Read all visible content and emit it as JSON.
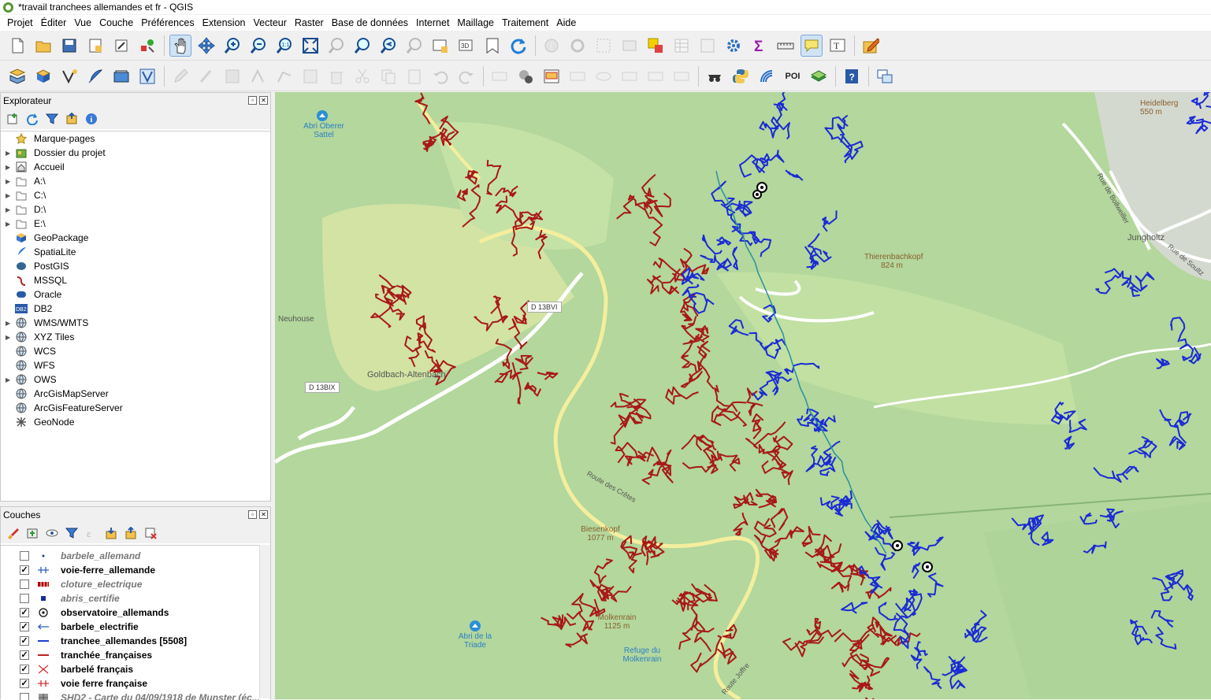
{
  "window": {
    "title": "*travail tranchees allemandes et fr - QGIS"
  },
  "menu": [
    "Projet",
    "Éditer",
    "Vue",
    "Couche",
    "Préférences",
    "Extension",
    "Vecteur",
    "Raster",
    "Base de données",
    "Internet",
    "Maillage",
    "Traitement",
    "Aide"
  ],
  "toolbar": {
    "poi_label": "POI"
  },
  "explorer": {
    "title": "Explorateur",
    "items": [
      {
        "label": "Marque-pages",
        "expand": false,
        "icon": "star-icon"
      },
      {
        "label": "Dossier du projet",
        "expand": true,
        "icon": "folder-project-icon"
      },
      {
        "label": "Accueil",
        "expand": true,
        "icon": "home-icon"
      },
      {
        "label": "A:\\",
        "expand": true,
        "icon": "folder-icon"
      },
      {
        "label": "C:\\",
        "expand": true,
        "icon": "folder-icon"
      },
      {
        "label": "D:\\",
        "expand": true,
        "icon": "folder-icon"
      },
      {
        "label": "E:\\",
        "expand": true,
        "icon": "folder-icon"
      },
      {
        "label": "GeoPackage",
        "expand": false,
        "icon": "geopackage-icon"
      },
      {
        "label": "SpatiaLite",
        "expand": false,
        "icon": "spatialite-icon"
      },
      {
        "label": "PostGIS",
        "expand": false,
        "icon": "postgis-icon"
      },
      {
        "label": "MSSQL",
        "expand": false,
        "icon": "mssql-icon"
      },
      {
        "label": "Oracle",
        "expand": false,
        "icon": "oracle-icon"
      },
      {
        "label": "DB2",
        "expand": false,
        "icon": "db2-icon"
      },
      {
        "label": "WMS/WMTS",
        "expand": true,
        "icon": "globe-icon"
      },
      {
        "label": "XYZ Tiles",
        "expand": true,
        "icon": "globe-icon"
      },
      {
        "label": "WCS",
        "expand": false,
        "icon": "globe-icon"
      },
      {
        "label": "WFS",
        "expand": false,
        "icon": "globe-icon"
      },
      {
        "label": "OWS",
        "expand": true,
        "icon": "globe-icon"
      },
      {
        "label": "ArcGisMapServer",
        "expand": false,
        "icon": "globe-icon"
      },
      {
        "label": "ArcGisFeatureServer",
        "expand": false,
        "icon": "globe-icon"
      },
      {
        "label": "GeoNode",
        "expand": false,
        "icon": "geonode-icon"
      }
    ]
  },
  "layers": {
    "title": "Couches",
    "items": [
      {
        "label": "barbele_allemand",
        "checked": false,
        "symbol": "dot-small",
        "color": "#1a3a8c"
      },
      {
        "label": "voie-ferre_allemande",
        "checked": true,
        "symbol": "rail",
        "color": "#2f5fbf"
      },
      {
        "label": "cloture_electrique",
        "checked": false,
        "symbol": "fence",
        "color": "#b00000"
      },
      {
        "label": "abris_certifie",
        "checked": false,
        "symbol": "square",
        "color": "#1a2aa0"
      },
      {
        "label": "observatoire_allemands",
        "checked": true,
        "symbol": "target",
        "color": "#000000"
      },
      {
        "label": "barbele_electrifie",
        "checked": true,
        "symbol": "arrow-line",
        "color": "#2f5fbf"
      },
      {
        "label": "tranchee_allemandes [5508]",
        "checked": true,
        "symbol": "line",
        "color": "#1f3fd0"
      },
      {
        "label": "tranchée_françaises",
        "checked": true,
        "symbol": "line",
        "color": "#c02020"
      },
      {
        "label": "barbelé français",
        "checked": true,
        "symbol": "cross",
        "color": "#d03030"
      },
      {
        "label": "voie ferre française",
        "checked": true,
        "symbol": "rail",
        "color": "#d03030"
      },
      {
        "label": "SHD2 - Carte du 04/09/1918 de Munster (éc...",
        "checked": false,
        "symbol": "raster",
        "color": "#888888"
      }
    ]
  },
  "map": {
    "labels": [
      "Abri Oberer Sattel",
      "Neuhouse",
      "Goldbach-Altenbach",
      "D 13BIX",
      "D 13BVI",
      "Route des Crêtes",
      "Thierenbachkopf 824 m",
      "Jungholtz",
      "Heidelberg 550 m",
      "Rue de Soultz",
      "Rue de Bollweiller",
      "Biesenkopf 1077 m",
      "Molkenrain 1125 m",
      "Refuge du Molkenrain",
      "Abri de la Triade",
      "Route Joffre"
    ],
    "colors": {
      "background": "#b5d9a0",
      "german_trench": "#1a2ad6",
      "french_trench": "#a81818",
      "road": "#ffffff",
      "main_road": "#f3eba0",
      "field": "#cfe5a8"
    }
  }
}
